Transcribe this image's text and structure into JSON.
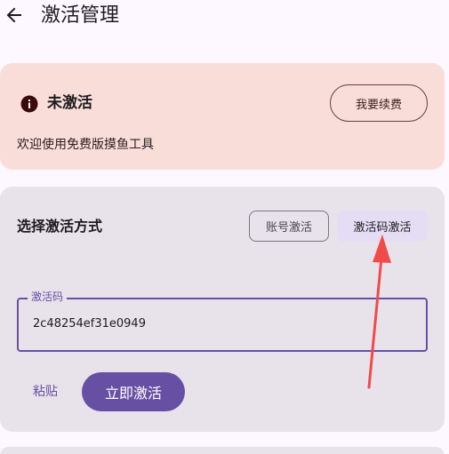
{
  "header": {
    "title": "激活管理",
    "back_icon": "arrow-left-icon"
  },
  "status_card": {
    "icon": "info-icon",
    "title": "未激活",
    "renew_label": "我要续费",
    "description": "欢迎使用免费版摸鱼工具",
    "background": "#f9ddd9"
  },
  "activation_card": {
    "title": "选择激活方式",
    "tabs": [
      {
        "label": "账号激活",
        "selected": false
      },
      {
        "label": "激活码激活",
        "selected": true
      }
    ],
    "code_field": {
      "label": "激活码",
      "value": "2c48254ef31e0949"
    },
    "paste_label": "粘贴",
    "activate_label": "立即激活"
  },
  "colors": {
    "accent": "#6750a4",
    "annotation_arrow": "#f04a4a",
    "page_bg": "#fdf7ff"
  }
}
